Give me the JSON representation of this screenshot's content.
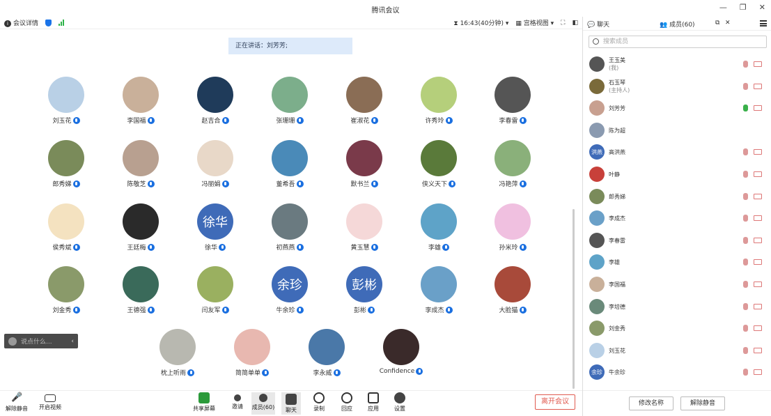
{
  "window": {
    "title": "腾讯会议"
  },
  "toolbar": {
    "meeting_details": "会议详情",
    "time": "16:43(40分钟)",
    "view_mode": "宫格视图"
  },
  "speaking": "正在讲话：刘芳芳;",
  "participants": [
    {
      "name": "刘玉花",
      "color": "#b9d0e6"
    },
    {
      "name": "李国福",
      "color": "#c9b09a"
    },
    {
      "name": "赵吉合",
      "color": "#1f3b5a"
    },
    {
      "name": "张珊珊",
      "color": "#7cae8b"
    },
    {
      "name": "崔淑花",
      "color": "#8a6d55"
    },
    {
      "name": "许秀玲",
      "color": "#b5cf7b"
    },
    {
      "name": "李春雷",
      "color": "#555555"
    },
    {
      "name": "郎秀娣",
      "color": "#7a8b5a"
    },
    {
      "name": "陈敬芝",
      "color": "#b8a090"
    },
    {
      "name": "冯丽娟",
      "color": "#e8d8c8"
    },
    {
      "name": "董希吾",
      "color": "#4a8ab8"
    },
    {
      "name": "默书兰",
      "color": "#7a3a4a"
    },
    {
      "name": "侠义天下",
      "color": "#5a7a3a"
    },
    {
      "name": "冯艳萍",
      "color": "#8ab07a"
    },
    {
      "name": "侯秀斌",
      "color": "#f4e2c0"
    },
    {
      "name": "王廷梅",
      "color": "#2a2a2a"
    },
    {
      "name": "徐华",
      "color": "#3f6bb8",
      "initials": "徐华"
    },
    {
      "name": "初燕燕",
      "color": "#6a7a80"
    },
    {
      "name": "黄玉慧",
      "color": "#f5d8d8"
    },
    {
      "name": "李雄",
      "color": "#5ea3c8"
    },
    {
      "name": "孙米玲",
      "color": "#f0c0e0"
    },
    {
      "name": "刘金秀",
      "color": "#8a9a6a"
    },
    {
      "name": "王德强",
      "color": "#3a6a5a"
    },
    {
      "name": "闫友军",
      "color": "#9ab060"
    },
    {
      "name": "牛余珍",
      "color": "#3f6bb8",
      "initials": "余珍"
    },
    {
      "name": "彭彬",
      "color": "#3f6bb8",
      "initials": "彭彬"
    },
    {
      "name": "李成杰",
      "color": "#6aa0c8"
    },
    {
      "name": "大脸猫",
      "color": "#a84a3a"
    },
    {
      "name": "枕上听雨",
      "color": "#b8b8b0"
    },
    {
      "name": "简简单单",
      "color": "#e8b8b0"
    },
    {
      "name": "李永威",
      "color": "#4a78a8"
    },
    {
      "name": "Confidence",
      "color": "#3a2a2a"
    }
  ],
  "chat_input": {
    "placeholder": "说点什么..."
  },
  "bottom": {
    "unmute": "解除静音",
    "start_video": "开启视频",
    "share": "共享屏幕",
    "invite": "邀请",
    "members": "成员(60)",
    "chat": "聊天",
    "record": "录制",
    "reaction": "回应",
    "apps": "应用",
    "settings": "设置",
    "leave": "离开会议"
  },
  "panel": {
    "tab_chat": "聊天",
    "tab_members": "成员(60)",
    "search_placeholder": "搜索成员",
    "members": [
      {
        "name": "王玉美",
        "sub": "(我)",
        "color": "#555",
        "mic": "muted",
        "cam": "off"
      },
      {
        "name": "石玉琴",
        "sub": "(主持人)",
        "color": "#7a6a3a",
        "mic": "muted",
        "cam": "off"
      },
      {
        "name": "刘芳芳",
        "sub": "",
        "color": "#c8a090",
        "mic": "active",
        "cam": "off"
      },
      {
        "name": "陈为超",
        "sub": "",
        "color": "#8a9ab0",
        "mic": "none",
        "cam": "none"
      },
      {
        "name": "高洪燕",
        "sub": "",
        "color": "#3f6bb8",
        "initials": "洪燕",
        "mic": "muted",
        "cam": "off"
      },
      {
        "name": "叶静",
        "sub": "",
        "color": "#c8403a",
        "mic": "muted",
        "cam": "off"
      },
      {
        "name": "郎秀娣",
        "sub": "",
        "color": "#7a8b5a",
        "mic": "muted",
        "cam": "off"
      },
      {
        "name": "李成杰",
        "sub": "",
        "color": "#6aa0c8",
        "mic": "muted",
        "cam": "off"
      },
      {
        "name": "李春雷",
        "sub": "",
        "color": "#555",
        "mic": "muted",
        "cam": "off"
      },
      {
        "name": "李雄",
        "sub": "",
        "color": "#5ea3c8",
        "mic": "muted",
        "cam": "off"
      },
      {
        "name": "李国福",
        "sub": "",
        "color": "#c9b09a",
        "mic": "muted",
        "cam": "off"
      },
      {
        "name": "李培德",
        "sub": "",
        "color": "#6a8a7a",
        "mic": "muted",
        "cam": "off"
      },
      {
        "name": "刘金秀",
        "sub": "",
        "color": "#8a9a6a",
        "mic": "muted",
        "cam": "off"
      },
      {
        "name": "刘玉花",
        "sub": "",
        "color": "#b9d0e6",
        "mic": "muted",
        "cam": "off"
      },
      {
        "name": "牛余珍",
        "sub": "",
        "color": "#3f6bb8",
        "initials": "余珍",
        "mic": "muted",
        "cam": "off"
      }
    ],
    "rename": "修改名称",
    "unmute_all": "解除静音"
  }
}
